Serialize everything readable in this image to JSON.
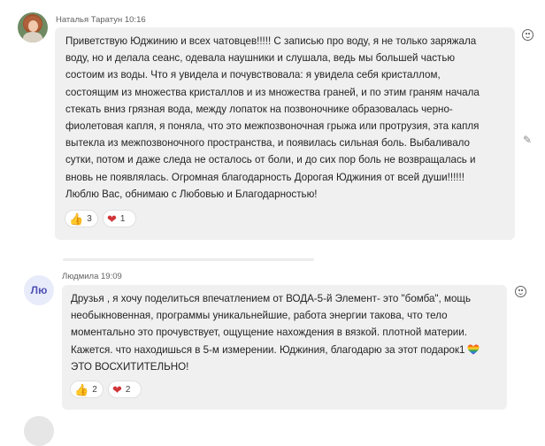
{
  "messages": [
    {
      "author": "Наталья Таратун",
      "time": "10:16",
      "lines": [
        "Приветствую Юджинию и всех чатовцев!!!!! С записью про воду, я не только заряжала",
        "воду, но и делала сеанс, одевала наушники и слушала, ведь мы большей частью",
        "состоим из воды. Что я увидела и почувствовала: я увидела себя кристаллом,",
        "состоящим из множества кристаллов и из множества граней, и по этим граням начала",
        "стекать вниз грязная вода, между лопаток на позвоночнике образовалась черно-",
        "фиолетовая капля, я поняла, что это межпозвоночная грыжа или протрузия, эта капля",
        "вытекла из межпозвоночного пространства, и появилась сильная боль. Выбаливало",
        "сутки, потом и даже следа не осталось от боли, и до сих пор боль не возвращалась и",
        "вновь не появлялась. Огромная благодарность Дорогая Юджиния от всей души!!!!!!",
        "Люблю Вас, обнимаю с Любовью и Благодарностью!"
      ],
      "reactions": [
        {
          "icon": "thumbs-up-icon",
          "count": "3"
        },
        {
          "icon": "heart-icon",
          "count": "1"
        }
      ]
    },
    {
      "author": "Людмила",
      "time": "19:09",
      "avatar_initials": "Лю",
      "lines": [
        "Друзья , я хочу поделиться впечатлением от ВОДА-5-й  Элемент- это \"бомба\", мощь",
        "необыкновенная, программы уникальнейшие, работа энергии такова, что тело",
        "моментально это прочувствует, ощущение нахождения в вязкой. плотной материи.",
        "Кажется. что находишься в 5-м измерении. Юджиния, благодарю за этот подарок1",
        "ЭТО ВОСХИТИТЕЛЬНО!"
      ],
      "reactions": [
        {
          "icon": "thumbs-up-icon",
          "count": "2"
        },
        {
          "icon": "heart-icon",
          "count": "2"
        }
      ]
    }
  ],
  "colors": {
    "bubble": "#f0f0f0",
    "heart": "#d13438",
    "thumb": "#e8b13a",
    "avatar_accent": "#4f52b2"
  }
}
